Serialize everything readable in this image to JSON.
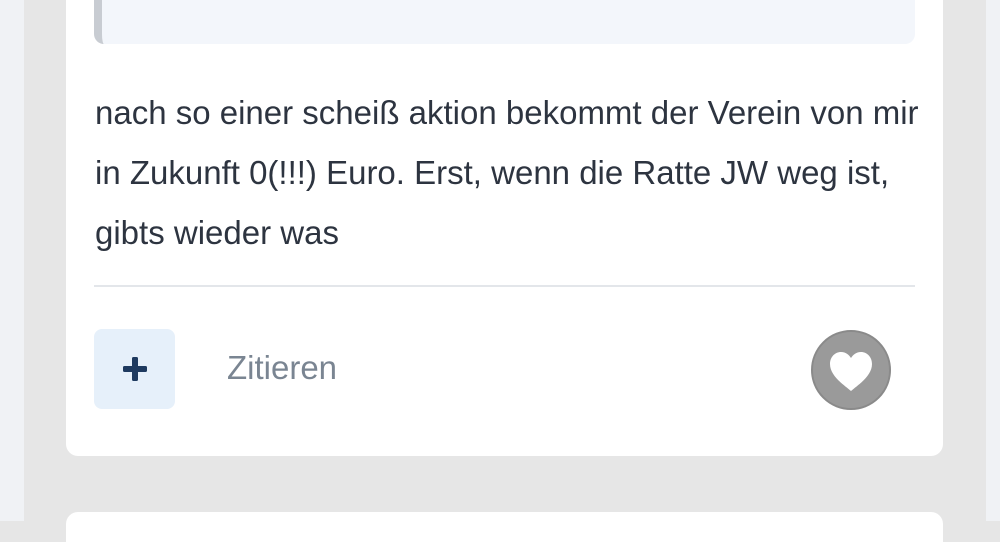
{
  "post": {
    "text": "nach so einer scheiß aktion bekommt der Verein von mir in Zukunft 0(!!!) Euro. Erst, wenn die Ratte JW weg ist, gibts wieder was"
  },
  "actions": {
    "plus_icon": "plus-icon",
    "quote_label": "Zitieren",
    "like_icon": "heart-icon"
  },
  "colors": {
    "plus_accent": "#1e3a5f",
    "plus_bg": "#e6f0fa",
    "like_circle": "#9a9a9a",
    "text": "#2d3440",
    "muted_text": "#7a8592"
  }
}
